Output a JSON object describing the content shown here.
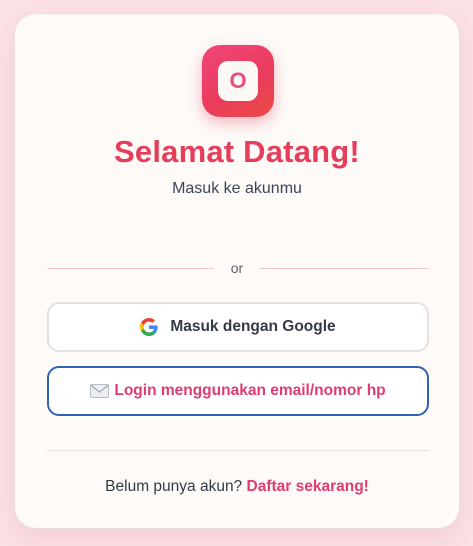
{
  "logo": {
    "letter": "O"
  },
  "header": {
    "title": "Selamat Datang!",
    "subtitle": "Masuk ke akunmu"
  },
  "divider": {
    "label": "or"
  },
  "buttons": {
    "google_label": "Masuk dengan Google",
    "email_label": "Login menggunakan email/nomor hp"
  },
  "footer": {
    "prompt": "Belum punya akun?",
    "link_label": "Daftar sekarang!"
  },
  "icons": {
    "google": "google-icon",
    "mail": "envelope-icon"
  },
  "colors": {
    "accent": "#e43e5b",
    "link": "#e03b72",
    "email_border": "#2f62b3"
  }
}
